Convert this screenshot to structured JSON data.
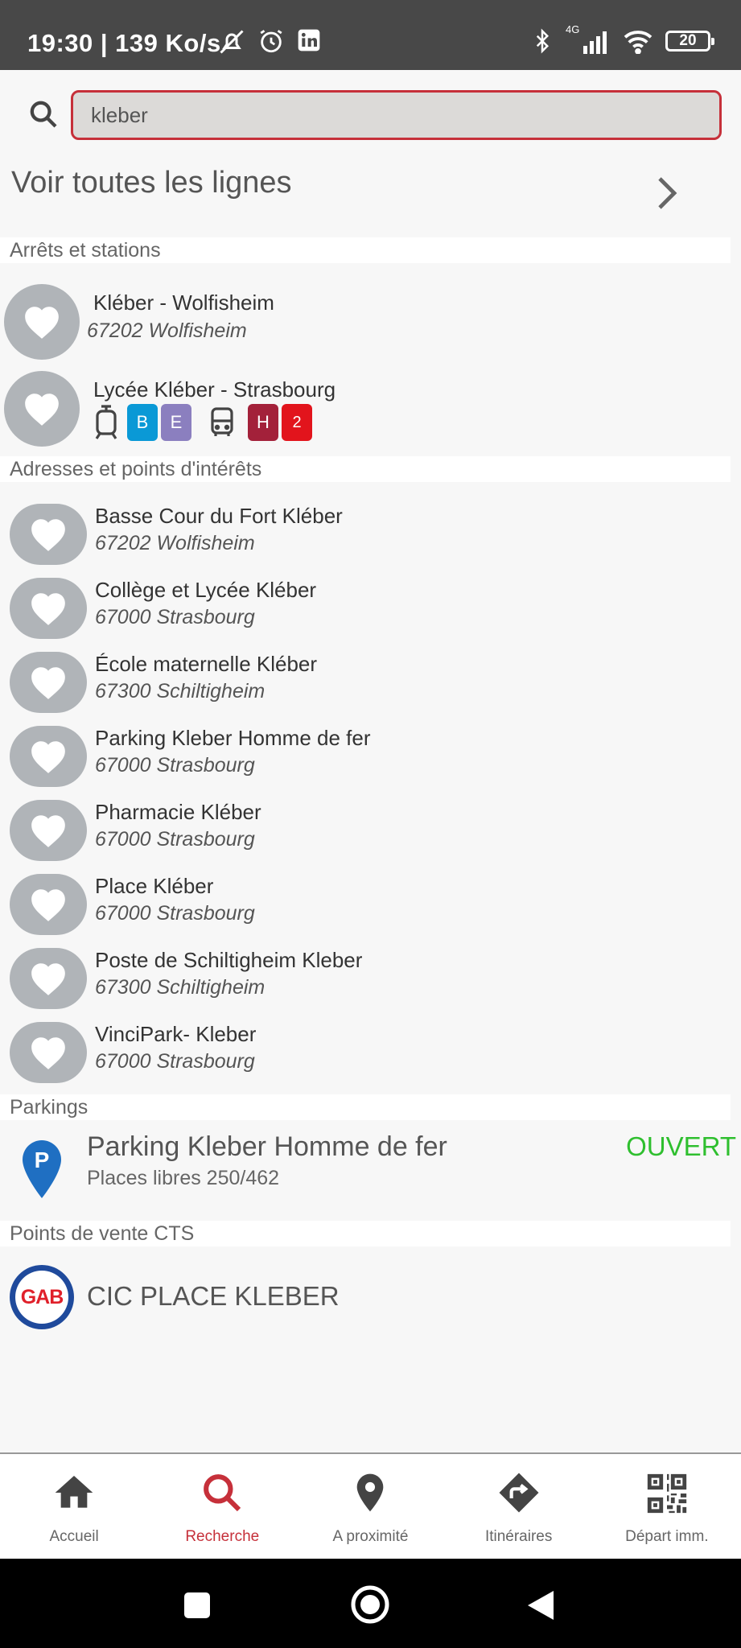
{
  "status_bar": {
    "time_speed": "19:30 | 139 Ko/s",
    "battery": "20",
    "network": "4G"
  },
  "search": {
    "value": "kleber",
    "placeholder": ""
  },
  "see_all_lines": "Voir toutes les lignes",
  "sections": {
    "stops": "Arrêts et stations",
    "addresses": "Adresses et points d'intérêts",
    "parkings": "Parkings",
    "points_of_sale": "Points de vente CTS"
  },
  "stops": [
    {
      "name": "Kléber - Wolfisheim",
      "sub": "67202 Wolfisheim"
    },
    {
      "name": "Lycée Kléber - Strasbourg"
    }
  ],
  "lines": {
    "tram": [
      {
        "label": "B",
        "color": "#0a99d6"
      },
      {
        "label": "E",
        "color": "#8b7fbf"
      }
    ],
    "bus": [
      {
        "label": "H",
        "color": "#a3213a"
      },
      {
        "label": "2",
        "color": "#e2141c"
      }
    ]
  },
  "addresses": [
    {
      "name": "Basse Cour du Fort Kléber",
      "sub": "67202 Wolfisheim"
    },
    {
      "name": "Collège et Lycée Kléber",
      "sub": "67000 Strasbourg"
    },
    {
      "name": "École maternelle Kléber",
      "sub": "67300 Schiltigheim"
    },
    {
      "name": "Parking Kleber Homme de fer",
      "sub": "67000 Strasbourg"
    },
    {
      "name": "Pharmacie Kléber",
      "sub": "67000 Strasbourg"
    },
    {
      "name": "Place Kléber",
      "sub": "67000 Strasbourg"
    },
    {
      "name": "Poste de Schiltigheim Kleber",
      "sub": "67300 Schiltigheim"
    },
    {
      "name": "VinciPark- Kleber",
      "sub": "67000 Strasbourg"
    }
  ],
  "parking": {
    "icon_letter": "P",
    "name": "Parking Kleber Homme de fer",
    "places": "Places libres 250/462",
    "status": "OUVERT"
  },
  "point_of_sale": {
    "logo_text": "GAB",
    "name": "CIC PLACE KLEBER"
  },
  "nav": [
    {
      "label": "Accueil",
      "icon": "home-icon"
    },
    {
      "label": "Recherche",
      "icon": "search-icon"
    },
    {
      "label": "A proximité",
      "icon": "location-pin-icon"
    },
    {
      "label": "Itinéraires",
      "icon": "directions-icon"
    },
    {
      "label": "Départ imm.",
      "icon": "qr-code-icon"
    }
  ],
  "colors": {
    "accent": "#c6303a",
    "open": "#2fbf2f",
    "heart_bg": "#b0b4b8"
  }
}
